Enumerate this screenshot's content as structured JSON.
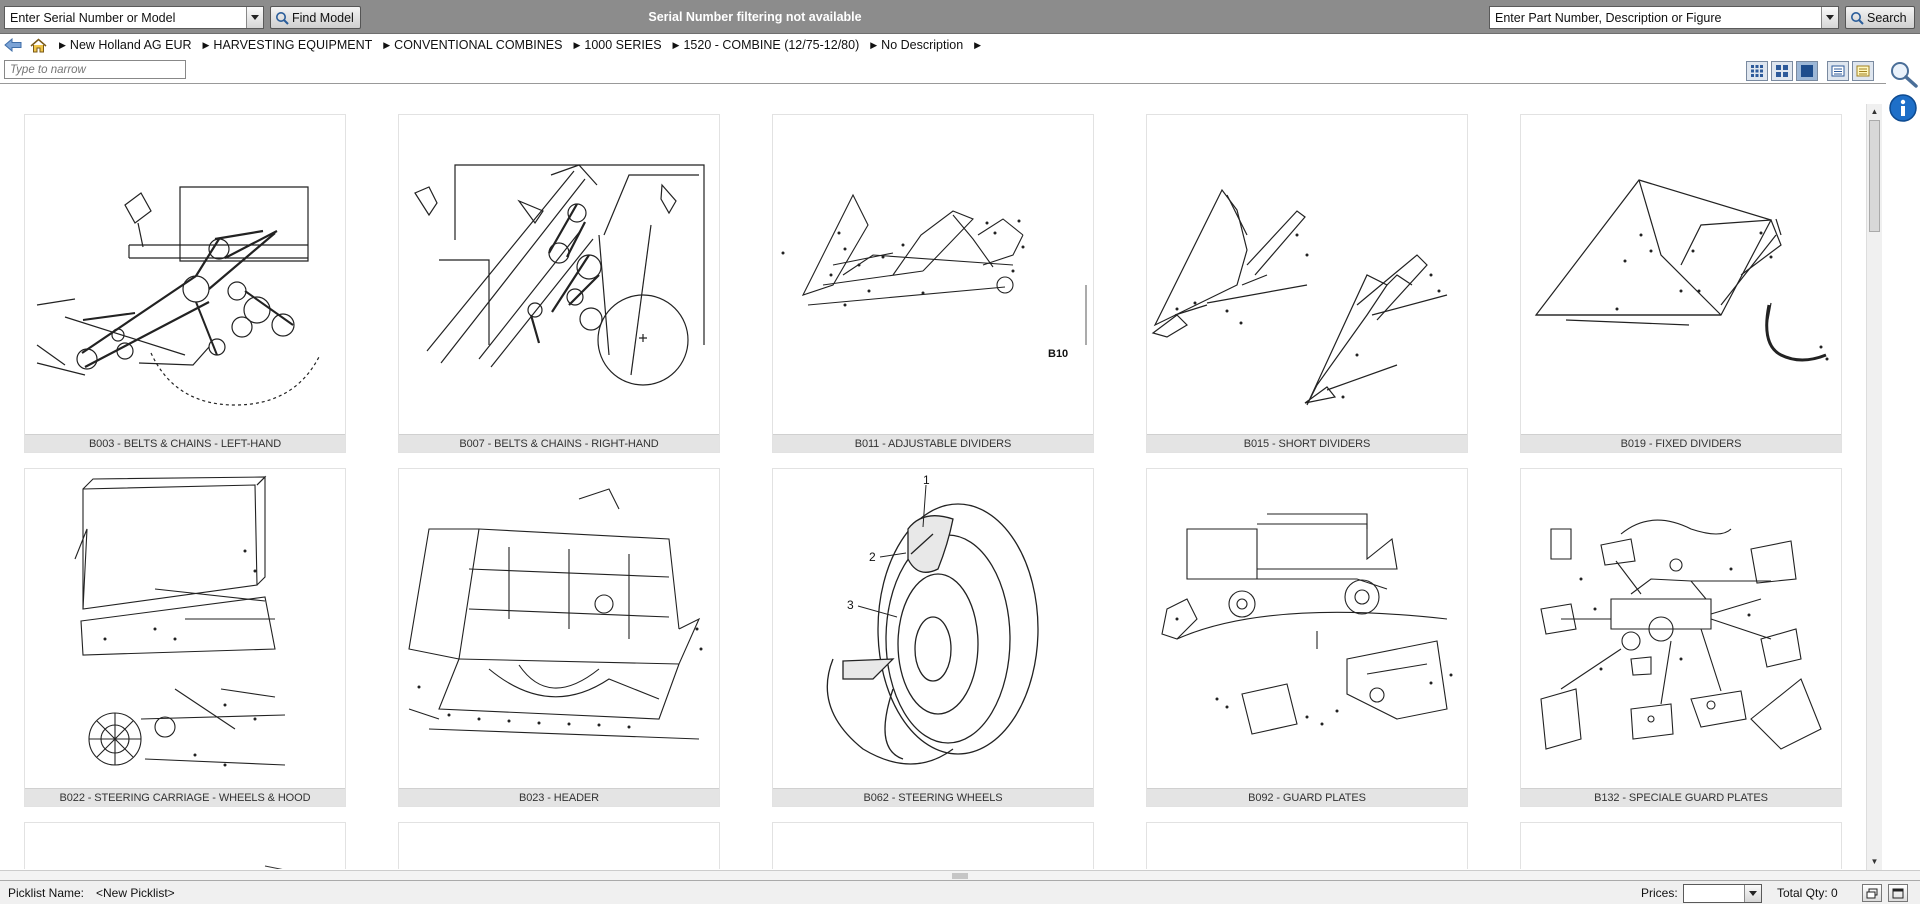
{
  "topbar": {
    "serial_placeholder": "Enter Serial Number or Model",
    "find_model_label": "Find Model",
    "serial_message": "Serial Number filtering not available",
    "part_placeholder": "Enter Part Number, Description or Figure",
    "search_label": "Search"
  },
  "breadcrumb": {
    "items": [
      {
        "label": "New Holland AG EUR"
      },
      {
        "label": "HARVESTING EQUIPMENT"
      },
      {
        "label": "CONVENTIONAL COMBINES"
      },
      {
        "label": "1000 SERIES"
      },
      {
        "label": "1520 - COMBINE (12/75-12/80)"
      },
      {
        "label": "No Description"
      }
    ]
  },
  "filter": {
    "narrow_placeholder": "Type to narrow"
  },
  "figures": [
    {
      "label": "B003 - BELTS & CHAINS - LEFT-HAND",
      "icon": "belts-chains-lh-drawing"
    },
    {
      "label": "B007 - BELTS & CHAINS - RIGHT-HAND",
      "icon": "belts-chains-rh-drawing"
    },
    {
      "label": "B011 - ADJUSTABLE DIVIDERS",
      "icon": "adjustable-dividers-drawing",
      "stamp": "B10"
    },
    {
      "label": "B015 - SHORT DIVIDERS",
      "icon": "short-dividers-drawing"
    },
    {
      "label": "B019 - FIXED DIVIDERS",
      "icon": "fixed-dividers-drawing"
    },
    {
      "label": "B022 - STEERING CARRIAGE - WHEELS & HOOD",
      "icon": "steering-carriage-drawing"
    },
    {
      "label": "B023 - HEADER",
      "icon": "header-drawing"
    },
    {
      "label": "B062 - STEERING WHEELS",
      "icon": "steering-wheels-drawing",
      "callouts": [
        "1",
        "2",
        "3"
      ]
    },
    {
      "label": "B092 - GUARD PLATES",
      "icon": "guard-plates-drawing"
    },
    {
      "label": "B132 - SPECIALE GUARD PLATES",
      "icon": "speciale-guard-plates-drawing"
    }
  ],
  "bottombar": {
    "picklist_label": "Picklist Name:",
    "picklist_value": "<New Picklist>",
    "prices_label": "Prices:",
    "total_qty": "Total Qty: 0"
  },
  "colors": {
    "topbar": "#8c8c8c",
    "caption_bg": "#e4e4e4",
    "accent_blue": "#1e6fc8"
  }
}
